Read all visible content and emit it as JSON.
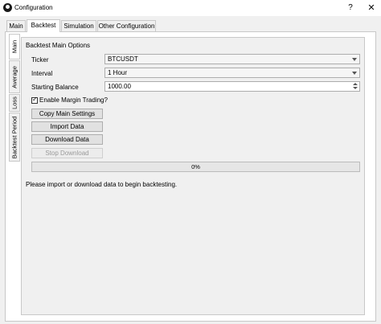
{
  "window": {
    "title": "Configuration",
    "help_label": "?",
    "close_label": "✕"
  },
  "tabs": [
    {
      "label": "Main"
    },
    {
      "label": "Backtest"
    },
    {
      "label": "Simulation"
    },
    {
      "label": "Other Configuration"
    }
  ],
  "side_tabs": [
    {
      "label": "Main"
    },
    {
      "label": "Average"
    },
    {
      "label": "Loss"
    },
    {
      "label": "Backtest Period"
    }
  ],
  "group": {
    "title": "Backtest Main Options",
    "ticker_label": "Ticker",
    "ticker_value": "BTCUSDT",
    "interval_label": "Interval",
    "interval_value": "1 Hour",
    "balance_label": "Starting Balance",
    "balance_value": "1000.00",
    "margin_label": "Enable Margin Trading?",
    "margin_checked": true,
    "buttons": {
      "copy": "Copy Main Settings",
      "import": "Import Data",
      "download": "Download Data",
      "stop": "Stop Download"
    },
    "progress_text": "0%",
    "progress_value": 0
  },
  "status_message": "Please import or download data to begin backtesting."
}
